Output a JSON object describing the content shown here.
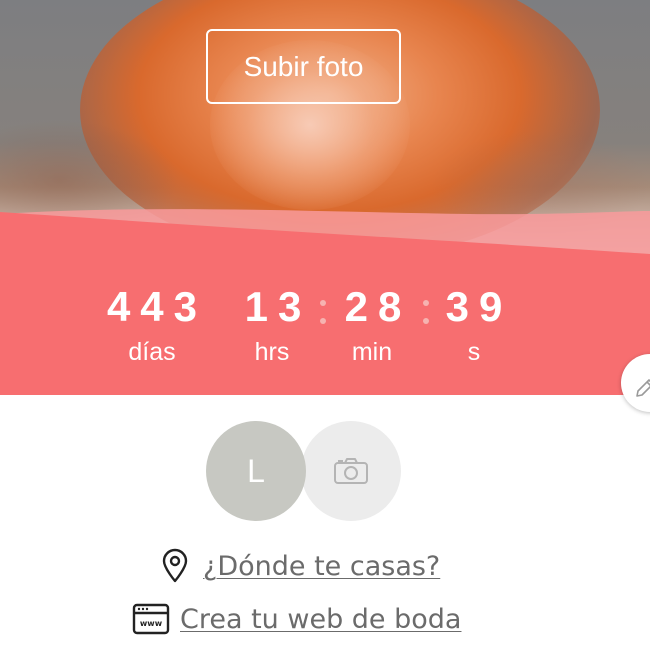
{
  "cover": {
    "upload_label": "Subir foto"
  },
  "countdown": {
    "days": "443",
    "days_label": "días",
    "hours": "13",
    "hours_label": "hrs",
    "minutes": "28",
    "minutes_label": "min",
    "seconds": "39",
    "seconds_label": "s"
  },
  "couple": {
    "initial": "L"
  },
  "links": {
    "where": "¿Dónde te casas?",
    "website": "Crea tu web de boda"
  },
  "icons": {
    "edit": "pencil-icon",
    "camera": "camera-icon",
    "location": "map-pin-icon",
    "website": "browser-window-icon"
  },
  "colors": {
    "accent": "#f76e70",
    "link_text": "#6b6b6b",
    "avatar_bg": "#c7c8c2",
    "camera_bg": "#ececec"
  }
}
